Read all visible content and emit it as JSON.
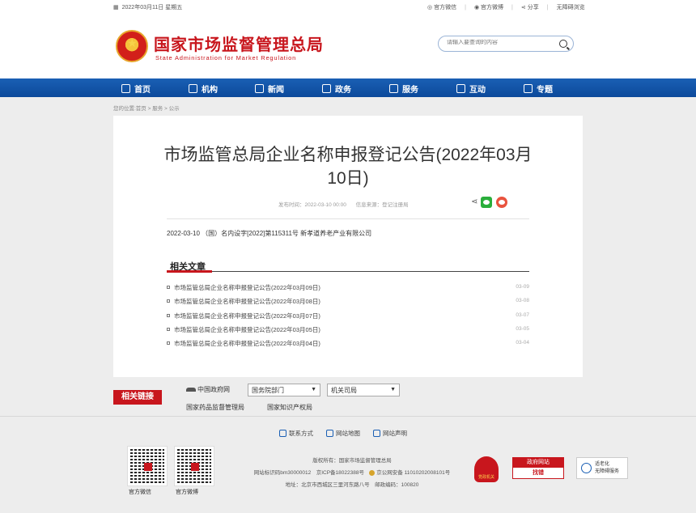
{
  "topbar": {
    "date": "2022年03月11日 星期五",
    "links": [
      "官方微信",
      "官方微博",
      "分享",
      "无障碍浏览"
    ]
  },
  "header": {
    "title": "国家市场监督管理总局",
    "subtitle": "State Administration for Market Regulation",
    "search_placeholder": "请输入要查询的内容"
  },
  "nav": [
    "首页",
    "机构",
    "新闻",
    "政务",
    "服务",
    "互动",
    "专题"
  ],
  "breadcrumb": "您的位置:首页 > 服务 > 公示",
  "article": {
    "title": "市场监管总局企业名称申报登记公告(2022年03月10日)",
    "publish_time": "发布时间：2022-03-10 00:00",
    "source": "信息来源：登记注册局",
    "content": "2022-03-10 （国）名内设字[2022]第115311号 新孝道养老产业有限公司"
  },
  "related": {
    "heading": "相关文章",
    "items": [
      {
        "title": "市场监管总局企业名称申报登记公告(2022年03月09日)",
        "date": "03-09"
      },
      {
        "title": "市场监管总局企业名称申报登记公告(2022年03月08日)",
        "date": "03-08"
      },
      {
        "title": "市场监管总局企业名称申报登记公告(2022年03月07日)",
        "date": "03-07"
      },
      {
        "title": "市场监管总局企业名称申报登记公告(2022年03月05日)",
        "date": "03-05"
      },
      {
        "title": "市场监管总局企业名称申报登记公告(2022年03月04日)",
        "date": "03-04"
      }
    ]
  },
  "related_links": {
    "label": "相关链接",
    "gov": "中国政府网",
    "select1": "国务院部门",
    "select2": "机关司局",
    "link1": "国家药品监督管理局",
    "link2": "国家知识产权局"
  },
  "footer": {
    "links": [
      "联系方式",
      "网站地图",
      "网站声明"
    ],
    "qr1": "官方微信",
    "qr2": "官方微博",
    "copyright": "版权所有：国家市场监督管理总局",
    "record": "网站标识码bm30000012　京ICP备18022388号　",
    "police": "京公网安备 11010202008101号",
    "address": "地址：北京市西城区三里河东路八号　邮政编码：100820",
    "badge1": "党政机关",
    "badge2_top": "政府网站",
    "badge2_bottom": "找错",
    "badge3_line1": "适老化",
    "badge3_line2": "无障碍服务"
  }
}
